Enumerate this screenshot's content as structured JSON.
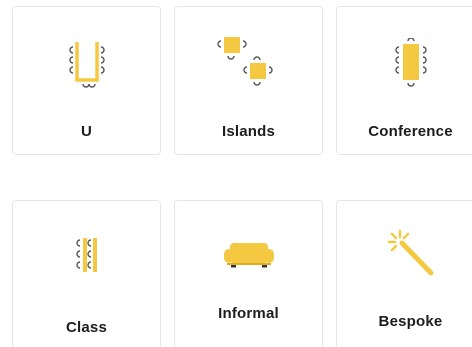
{
  "layouts": [
    {
      "id": "u",
      "label": "U",
      "icon": "u-shape-table-icon"
    },
    {
      "id": "islands",
      "label": "Islands",
      "icon": "islands-tables-icon"
    },
    {
      "id": "conference",
      "label": "Conference",
      "icon": "conference-table-icon"
    },
    {
      "id": "class",
      "label": "Class",
      "icon": "classroom-rows-icon"
    },
    {
      "id": "informal",
      "label": "Informal",
      "icon": "sofa-icon"
    },
    {
      "id": "bespoke",
      "label": "Bespoke",
      "icon": "magic-wand-icon"
    }
  ],
  "colors": {
    "accent": "#f5c842",
    "accent_dark": "#e0ae1f",
    "chair": "#555555",
    "border": "#e6e6e6",
    "text": "#1d1d1d"
  }
}
